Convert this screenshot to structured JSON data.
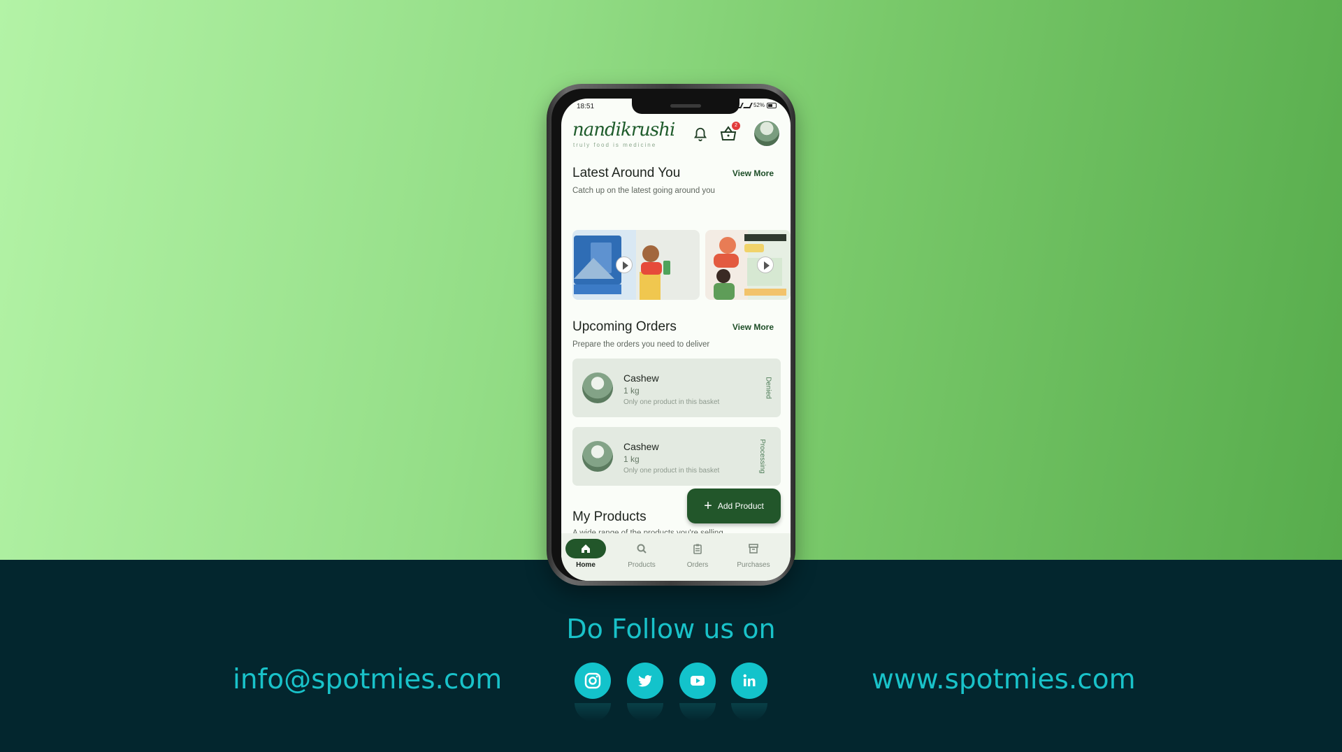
{
  "status": {
    "time": "18:51",
    "battery": "52%"
  },
  "app": {
    "logo": "nandikrushi",
    "tagline": "truly food is medicine",
    "cart_count": "2"
  },
  "latest": {
    "title": "Latest Around You",
    "view_more": "View More",
    "subtitle": "Catch up on the latest going around you"
  },
  "upcoming": {
    "title": "Upcoming Orders",
    "view_more": "View More",
    "subtitle": "Prepare the orders you need to deliver",
    "orders": [
      {
        "name": "Cashew",
        "qty": "1 kg",
        "note": "Only one product in this basket",
        "status": "Denied"
      },
      {
        "name": "Cashew",
        "qty": "1 kg",
        "note": "Only one product in this basket",
        "status": "Processing"
      }
    ]
  },
  "my_products": {
    "title": "My Products",
    "subtitle": "A wide range of the products you're selling"
  },
  "fab": {
    "label": "Add Product"
  },
  "nav": [
    {
      "label": "Home",
      "icon": "home-icon"
    },
    {
      "label": "Products",
      "icon": "search-icon"
    },
    {
      "label": "Orders",
      "icon": "clipboard-icon"
    },
    {
      "label": "Purchases",
      "icon": "archive-icon"
    }
  ],
  "footer": {
    "follow": "Do Follow us on",
    "email": "info@spotmies.com",
    "website": "www.spotmies.com",
    "socials": [
      "instagram-icon",
      "twitter-icon",
      "youtube-icon",
      "linkedin-icon"
    ]
  },
  "colors": {
    "accent": "#22562a",
    "teal": "#19c2c9",
    "footer_bg": "#03262e"
  }
}
